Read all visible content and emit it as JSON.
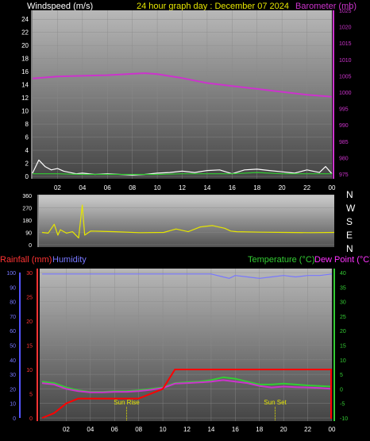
{
  "header": {
    "windspeed_label": "Windspeed (m/s)",
    "title": "24 hour graph day : December 07 2024",
    "barometer_label": "Barometer (mb)"
  },
  "direction_letters": [
    "N",
    "W",
    "S",
    "E",
    "N"
  ],
  "bottom_header": {
    "rainfall_label": "Rainfall (mm)",
    "humidity_label": "Humidity",
    "temperature_label": "Temperature (°C)",
    "dewpoint_label": "Dew Point (°C)"
  },
  "annotations": {
    "sunrise": "Sun Rise",
    "sunset": "Sun Set"
  },
  "colors": {
    "wind": "#ffffff",
    "wind_avg": "#33cc33",
    "barometer": "#cc33cc",
    "direction": "#e6e600",
    "rain": "#ff0000",
    "humidity": "#7777ff",
    "temperature": "#33cc33",
    "dewpoint": "#cc33cc",
    "title": "#e6e600",
    "rain_label": "#ff3333",
    "humidity_label": "#7777ff",
    "temp_label": "#33cc33",
    "dew_label": "#ff33ff",
    "sun_marker": "#e6e600"
  },
  "chart_data": [
    {
      "type": "line",
      "title": "24 hour graph day : December 07 2024",
      "x_ticks": [
        "02",
        "04",
        "06",
        "08",
        "10",
        "12",
        "14",
        "16",
        "18",
        "20",
        "22",
        "00"
      ],
      "y_left": {
        "label": "Windspeed (m/s)",
        "range": [
          0,
          25
        ],
        "ticks": [
          0,
          2,
          4,
          6,
          8,
          10,
          12,
          14,
          16,
          18,
          20,
          22,
          24
        ]
      },
      "y_right": {
        "label": "Barometer (mb)",
        "range": [
          973,
          1025
        ],
        "ticks": [
          975,
          980,
          985,
          990,
          995,
          1000,
          1005,
          1010,
          1015,
          1020,
          1025
        ]
      },
      "series": [
        {
          "name": "Barometer (mb)",
          "axis": "right",
          "x": [
            0,
            2,
            4,
            6,
            8,
            9,
            10,
            12,
            14,
            16,
            18,
            20,
            22,
            24
          ],
          "values": [
            1004.2,
            1004.8,
            1005.0,
            1005.2,
            1005.6,
            1005.8,
            1005.5,
            1004.3,
            1002.8,
            1001.9,
            1001.0,
            1000.1,
            999.2,
            998.6
          ]
        },
        {
          "name": "Windspeed (m/s)",
          "axis": "left",
          "x": [
            0,
            0.5,
            1,
            1.5,
            2,
            2.5,
            3,
            3.5,
            4,
            5,
            6,
            7,
            8,
            9,
            10,
            11,
            12,
            13,
            14,
            15,
            16,
            17,
            18,
            19,
            20,
            21,
            22,
            23,
            23.5,
            24
          ],
          "values": [
            0.5,
            2.5,
            1.5,
            1.0,
            1.2,
            0.8,
            0.6,
            0.4,
            0.5,
            0.3,
            0.4,
            0.3,
            0.2,
            0.3,
            0.5,
            0.6,
            0.8,
            0.6,
            0.9,
            1.0,
            0.4,
            1.0,
            1.1,
            0.9,
            0.7,
            0.5,
            1.0,
            0.6,
            1.5,
            0.4
          ]
        },
        {
          "name": "Wind average",
          "x": [
            0,
            2,
            4,
            6,
            8,
            10,
            12,
            14,
            16,
            18,
            20,
            22,
            24
          ],
          "values": [
            0.4,
            0.4,
            0.3,
            0.3,
            0.3,
            0.3,
            0.4,
            0.4,
            0.4,
            0.6,
            0.4,
            0.4,
            0.4
          ]
        }
      ]
    },
    {
      "type": "line",
      "y_ticks": [
        0,
        90,
        180,
        270,
        360
      ],
      "y_range": [
        0,
        360
      ],
      "series": [
        {
          "name": "Wind direction",
          "x": [
            0,
            0.5,
            1,
            1.3,
            1.5,
            2,
            2.5,
            3,
            3.3,
            3.5,
            4,
            6,
            8,
            10,
            11,
            12,
            13,
            14,
            15,
            15.5,
            16,
            18,
            20,
            22,
            24
          ],
          "values": [
            90,
            85,
            150,
            70,
            110,
            85,
            95,
            50,
            290,
            70,
            100,
            95,
            88,
            90,
            115,
            95,
            130,
            140,
            120,
            100,
            95,
            92,
            90,
            88,
            90
          ]
        }
      ]
    },
    {
      "type": "line",
      "x_ticks": [
        "02",
        "04",
        "06",
        "08",
        "10",
        "12",
        "14",
        "16",
        "18",
        "20",
        "22",
        "00"
      ],
      "y_left": {
        "label": "Rainfall (mm)",
        "range": [
          0,
          30
        ],
        "ticks": [
          0,
          5,
          10,
          15,
          20,
          25,
          30
        ]
      },
      "y_outer": {
        "label": "Humidity",
        "range": [
          0,
          100
        ],
        "ticks": [
          0,
          10,
          20,
          30,
          40,
          50,
          60,
          70,
          80,
          90,
          100
        ]
      },
      "y_right": {
        "label": "Temperature (°C)",
        "range": [
          -10,
          40
        ],
        "ticks": [
          -10,
          -5,
          0,
          5,
          10,
          15,
          20,
          25,
          30,
          35,
          40
        ]
      },
      "series": [
        {
          "name": "Humidity",
          "axis": "outer",
          "x": [
            0,
            14,
            15,
            15.5,
            16,
            17,
            18,
            19,
            20,
            21,
            22,
            23,
            24
          ],
          "values": [
            99,
            99,
            97,
            96,
            98,
            97,
            96,
            97,
            98,
            97,
            98,
            98,
            99
          ]
        },
        {
          "name": "Temperature (°C)",
          "axis": "right",
          "x": [
            0,
            1,
            2,
            3,
            4,
            5,
            6,
            7,
            8,
            9,
            10,
            11,
            12,
            13,
            14,
            15,
            16,
            17,
            18,
            19,
            20,
            21,
            22,
            23,
            24
          ],
          "values": [
            2.5,
            2.0,
            0.5,
            -0.5,
            -1.0,
            -1.0,
            -0.8,
            -0.8,
            -0.5,
            0,
            0.5,
            2.0,
            2.3,
            2.5,
            3.0,
            4.0,
            3.5,
            2.5,
            1.5,
            1.5,
            1.8,
            1.5,
            1.2,
            1.0,
            0.8
          ]
        },
        {
          "name": "Dew Point (°C)",
          "axis": "right",
          "x": [
            0,
            1,
            2,
            3,
            4,
            5,
            6,
            7,
            8,
            9,
            10,
            11,
            12,
            13,
            14,
            15,
            16,
            17,
            18,
            19,
            20,
            21,
            22,
            23,
            24
          ],
          "values": [
            2.0,
            1.5,
            0,
            -0.8,
            -1.2,
            -1.2,
            -1.0,
            -1.0,
            -0.8,
            -0.3,
            0.3,
            1.8,
            2.0,
            2.2,
            2.5,
            3.0,
            2.5,
            2.0,
            1.0,
            0.5,
            0.8,
            0.6,
            0.5,
            0.3,
            0.0
          ]
        },
        {
          "name": "Rainfall (mm)",
          "axis": "left",
          "x": [
            0,
            1,
            1.5,
            2,
            3,
            6,
            8,
            9,
            10,
            10.5,
            11,
            12,
            20,
            24
          ],
          "values": [
            0,
            1,
            2,
            3,
            4,
            4,
            4,
            5,
            6,
            8,
            10,
            10,
            10,
            10
          ]
        }
      ],
      "annotations": [
        {
          "text": "Sun Rise",
          "x": 7.0
        },
        {
          "text": "Sun Set",
          "x": 19.3
        }
      ]
    }
  ]
}
